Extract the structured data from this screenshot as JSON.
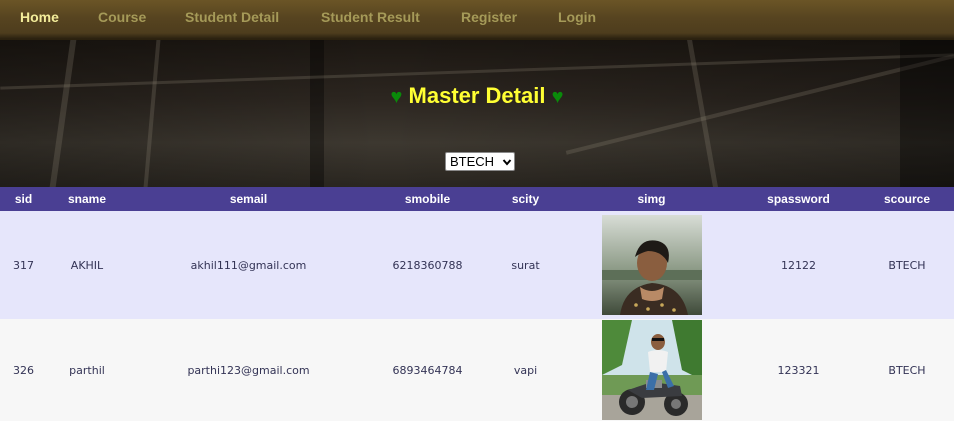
{
  "nav": {
    "items": [
      {
        "label": "Home",
        "active": true
      },
      {
        "label": "Course",
        "active": false
      },
      {
        "label": "Student Detail",
        "active": false
      },
      {
        "label": "Student Result",
        "active": false
      },
      {
        "label": "Register",
        "active": false
      },
      {
        "label": "Login",
        "active": false
      }
    ]
  },
  "hero": {
    "title": "Master Detail",
    "heart_glyph": "♥",
    "course_select": {
      "selected": "BTECH"
    }
  },
  "table": {
    "columns": [
      "sid",
      "sname",
      "semail",
      "smobile",
      "scity",
      "simg",
      "spassword",
      "scource"
    ],
    "rows": [
      {
        "sid": "317",
        "sname": "AKHIL",
        "semail": "akhil111@gmail.com",
        "smobile": "6218360788",
        "scity": "surat",
        "simg": "student-photo-portrait",
        "spassword": "12122",
        "scource": "BTECH"
      },
      {
        "sid": "326",
        "sname": "parthil",
        "semail": "parthi123@gmail.com",
        "smobile": "6893464784",
        "scity": "vapi",
        "simg": "student-photo-motorcycle",
        "spassword": "123321",
        "scource": "BTECH"
      }
    ]
  },
  "colors": {
    "nav_active": "#f3ec9a",
    "nav_inactive": "#a59a58",
    "title": "#ffff33",
    "heart": "#0a8a0a",
    "header_bg": "#4a3f93",
    "row_alt_bg": "#e6e6fb"
  }
}
